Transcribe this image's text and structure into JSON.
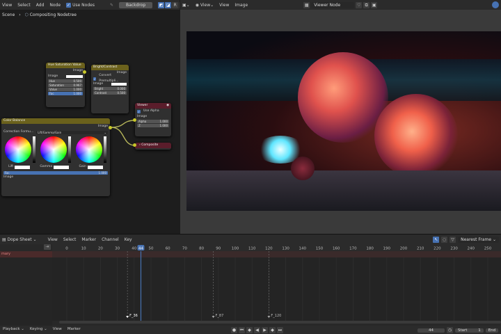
{
  "node_header": {
    "menus": [
      "View",
      "Select",
      "Add",
      "Node"
    ],
    "use_nodes": "Use Nodes",
    "backdrop": "Backdrop",
    "channels": [
      "R",
      "G",
      "B"
    ]
  },
  "breadcrumb": {
    "scene": "Scene",
    "tree": "Compositing Nodetree"
  },
  "nodes": {
    "hsv": {
      "title": "Hue Saturation Value",
      "out": "Image",
      "in": "Image",
      "fields": [
        {
          "label": "Hue",
          "value": "0.500"
        },
        {
          "label": "Saturation",
          "value": "0.967"
        },
        {
          "label": "Value",
          "value": "1.000"
        },
        {
          "label": "Fac",
          "value": "1.000"
        }
      ]
    },
    "bc": {
      "title": "Bright/Contrast",
      "out": "Image",
      "option": "Convert Premultipli...",
      "in": "Image",
      "fields": [
        {
          "label": "Bright",
          "value": "0.000"
        },
        {
          "label": "Contrast",
          "value": "0.500"
        }
      ]
    },
    "viewer": {
      "title": "Viewer",
      "option": "Use Alpha",
      "in": "Image",
      "fields": [
        {
          "label": "Alpha",
          "value": "1.000"
        },
        {
          "label": "Z",
          "value": "1.000"
        }
      ]
    },
    "composite": {
      "title": "Composite"
    },
    "cb": {
      "title": "Color Balance",
      "out": "Image",
      "method_label": "Correction Formu...",
      "method": "Lift/Gamma/Gain",
      "wheels": [
        "Lift",
        "Gamma",
        "Gain"
      ],
      "fac_label": "Fac",
      "fac": "1.000",
      "in": "Image"
    }
  },
  "viewer_header": {
    "menus": [
      "View",
      "View",
      "Image"
    ],
    "image": "Viewer Node"
  },
  "dope": {
    "editor": "Dope Sheet",
    "menus": [
      "View",
      "Select",
      "Marker",
      "Channel",
      "Key"
    ],
    "snap": "Nearest Frame",
    "current_frame": "44",
    "ticks": [
      "0",
      "10",
      "20",
      "30",
      "40",
      "44",
      "50",
      "60",
      "70",
      "80",
      "90",
      "100",
      "110",
      "120",
      "130",
      "140",
      "150",
      "160",
      "170",
      "180",
      "190",
      "200",
      "210",
      "220",
      "230",
      "240",
      "250"
    ],
    "channel": "mary",
    "markers": [
      "F_36",
      "F_87",
      "F_120"
    ]
  },
  "status": {
    "menus": [
      "Playback",
      "Keying",
      "View",
      "Marker"
    ],
    "frame": "44",
    "start_label": "Start",
    "start": "1",
    "end_label": "End"
  },
  "colors": {
    "accent": "#4772b3",
    "playhead": "#4772b3",
    "hsv_header": "#6b611c",
    "viewer_header": "#5a1d2b"
  }
}
